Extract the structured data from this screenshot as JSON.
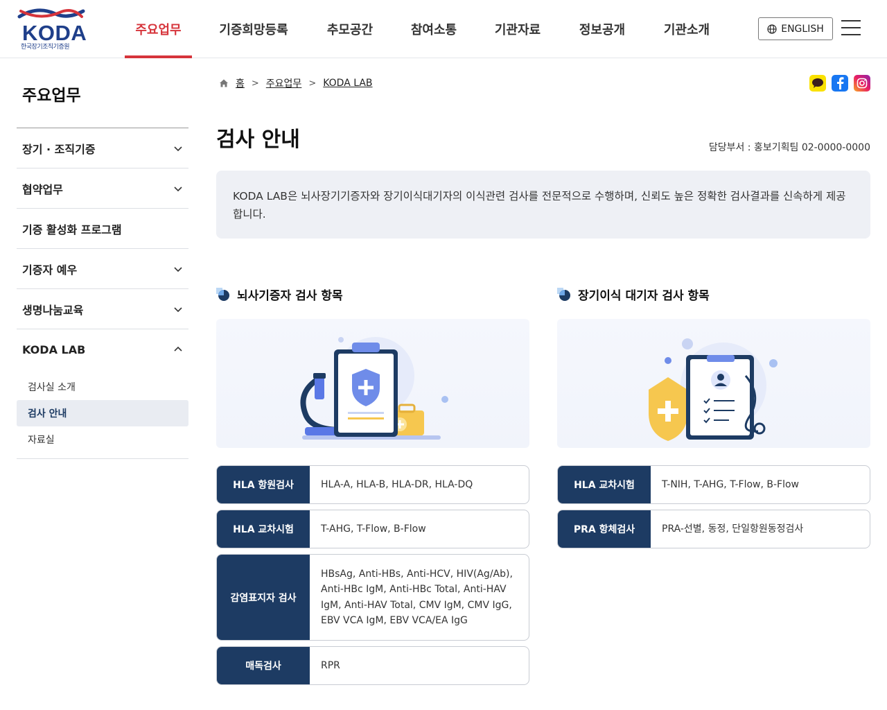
{
  "header": {
    "logo_text": "KODA",
    "logo_sub": "한국장기조직기증원",
    "nav": [
      {
        "label": "주요업무",
        "active": true
      },
      {
        "label": "기증희망등록",
        "active": false
      },
      {
        "label": "추모공간",
        "active": false
      },
      {
        "label": "참여소통",
        "active": false
      },
      {
        "label": "기관자료",
        "active": false
      },
      {
        "label": "정보공개",
        "active": false
      },
      {
        "label": "기관소개",
        "active": false
      }
    ],
    "lang_label": "ENGLISH"
  },
  "sidebar": {
    "title": "주요업무",
    "items": [
      {
        "label": "장기 · 조직기증"
      },
      {
        "label": "협약업무"
      },
      {
        "label": "기증 활성화 프로그램"
      },
      {
        "label": "기증자 예우"
      },
      {
        "label": "생명나눔교육"
      },
      {
        "label": "KODA LAB"
      }
    ],
    "sub_items": [
      {
        "label": "검사실 소개"
      },
      {
        "label": "검사 안내"
      },
      {
        "label": "자료실"
      }
    ]
  },
  "breadcrumb": {
    "home": "홈",
    "level1": "주요업무",
    "level2": "KODA LAB"
  },
  "page": {
    "title": "검사 안내",
    "dept": "담당부서 : 홍보기획팀 02-0000-0000",
    "intro": "KODA LAB은 뇌사장기기증자와 장기이식대기자의 이식관련 검사를 전문적으로 수행하며, 신뢰도 높은 정확한 검사결과를 신속하게 제공합니다."
  },
  "donor_section": {
    "title": "뇌사기증자 검사 항목",
    "rows": [
      {
        "label": "HLA 항원검사",
        "value": "HLA-A, HLA-B, HLA-DR, HLA-DQ"
      },
      {
        "label": "HLA 교차시험",
        "value": "T-AHG, T-Flow, B-Flow"
      },
      {
        "label": "감염표지자 검사",
        "value": "HBsAg, Anti-HBs, Anti-HCV, HIV(Ag/Ab), Anti-HBc IgM, Anti-HBc Total, Anti-HAV IgM, Anti-HAV Total, CMV IgM, CMV IgG, EBV VCA IgM, EBV VCA/EA IgG"
      },
      {
        "label": "매독검사",
        "value": "RPR"
      }
    ]
  },
  "recipient_section": {
    "title": "장기이식 대기자 검사 항목",
    "rows": [
      {
        "label": "HLA 교차시험",
        "value": "T-NIH, T-AHG, T-Flow, B-Flow"
      },
      {
        "label": "PRA 항체검사",
        "value": "PRA-선별, 동정, 단일항원동정검사"
      }
    ]
  },
  "colors": {
    "brand_navy": "#1d3b63",
    "active_red": "#d6343b",
    "logo_blue": "#1f3f8a"
  }
}
